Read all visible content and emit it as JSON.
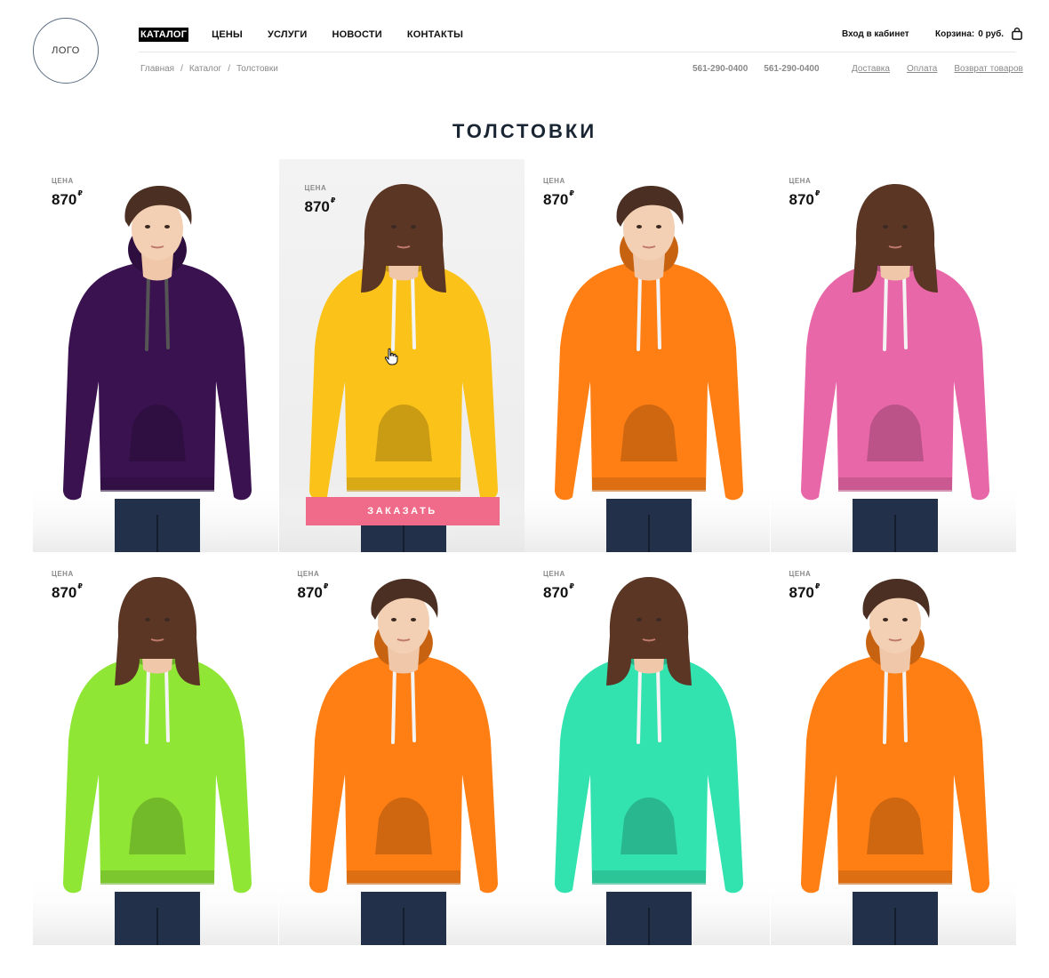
{
  "header": {
    "logo_text": "ЛОГО",
    "nav": [
      {
        "label": "КАТАЛОГ",
        "active": true
      },
      {
        "label": "ЦЕНЫ",
        "active": false
      },
      {
        "label": "УСЛУГИ",
        "active": false
      },
      {
        "label": "НОВОСТИ",
        "active": false
      },
      {
        "label": "КОНТАКТЫ",
        "active": false
      }
    ],
    "login": "Вход в кабинет",
    "cart_label": "Корзина:",
    "cart_value": "0 руб."
  },
  "breadcrumb": [
    {
      "label": "Главная"
    },
    {
      "label": "Каталог"
    },
    {
      "label": "Толстовки"
    }
  ],
  "phones": [
    "561-290-0400",
    "561-290-0400"
  ],
  "info_links": [
    {
      "label": "Доставка"
    },
    {
      "label": "Оплата"
    },
    {
      "label": "Возврат товаров"
    }
  ],
  "page_title": "ТОЛСТОВКИ",
  "products": [
    {
      "price_label": "ЦЕНА",
      "price": "870",
      "currency": "₽",
      "color": "#3a1250",
      "model": "male",
      "hovered": false
    },
    {
      "price_label": "ЦЕНА",
      "price": "870",
      "currency": "₽",
      "color": "#fbc21a",
      "model": "female",
      "hovered": true,
      "button": "ЗАКАЗАТЬ"
    },
    {
      "price_label": "ЦЕНА",
      "price": "870",
      "currency": "₽",
      "color": "#ff7f14",
      "model": "male",
      "hovered": false
    },
    {
      "price_label": "ЦЕНА",
      "price": "870",
      "currency": "₽",
      "color": "#e867a8",
      "model": "female",
      "hovered": false
    },
    {
      "price_label": "ЦЕНА",
      "price": "870",
      "currency": "₽",
      "color": "#8fe635",
      "model": "female",
      "hovered": false
    },
    {
      "price_label": "ЦЕНА",
      "price": "870",
      "currency": "₽",
      "color": "#ff7f14",
      "model": "male",
      "hovered": false
    },
    {
      "price_label": "ЦЕНА",
      "price": "870",
      "currency": "₽",
      "color": "#32e3b0",
      "model": "female",
      "hovered": false
    },
    {
      "price_label": "ЦЕНА",
      "price": "870",
      "currency": "₽",
      "color": "#ff7f14",
      "model": "male",
      "hovered": false
    }
  ]
}
